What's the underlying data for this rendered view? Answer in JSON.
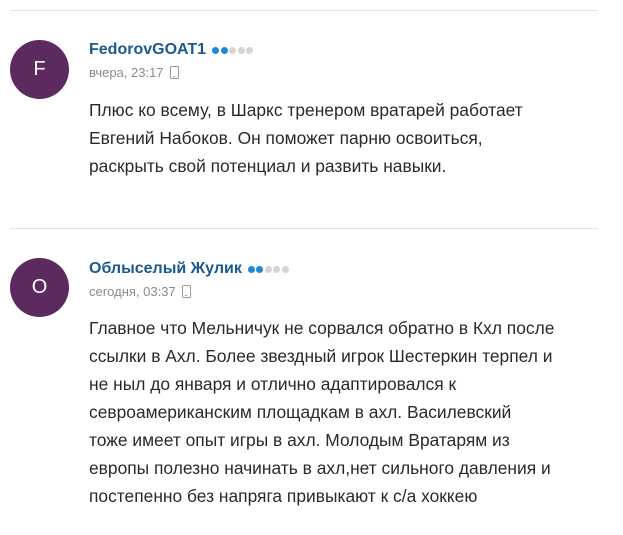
{
  "comments": [
    {
      "avatar_letter": "F",
      "author": "FedorovGOAT1",
      "rating_level": 2,
      "rating_max": 5,
      "time": "вчера, 23:17",
      "device_icon": "mobile-phone-icon",
      "lines": [
        "Плюс ко всему, в Шаркс тренером вратарей работает",
        "Евгений Набоков. Он поможет парню освоиться,",
        "раскрыть свой потенциал и развить навыки."
      ]
    },
    {
      "avatar_letter": "О",
      "author": "Облыселый Жулик",
      "rating_level": 2,
      "rating_max": 5,
      "time": "сегодня, 03:37",
      "device_icon": "mobile-phone-icon",
      "lines": [
        "Главное что Мельничук не сорвался обратно в Кхл после",
        "ссылки в Ахл. Более звездный игрок Шестеркин терпел и",
        "не ныл до января и отлично адаптировался к",
        "севроамериканским площадкам в ахл. Василевский",
        "тоже имеет опыт игры в ахл. Молодым Вратарям из",
        "европы полезно начинать в ахл,нет сильного давления и",
        "постепенно без напряга привыкают к с/а хоккею"
      ]
    }
  ],
  "colors": {
    "avatar_bg": "#5c2a5e",
    "author": "#1a5a8e",
    "rating_on": "#1e88d6",
    "rating_off": "#d5d5d5",
    "meta": "#8a8a8a",
    "text": "#2a2a2a",
    "divider": "#e3e3e3"
  }
}
